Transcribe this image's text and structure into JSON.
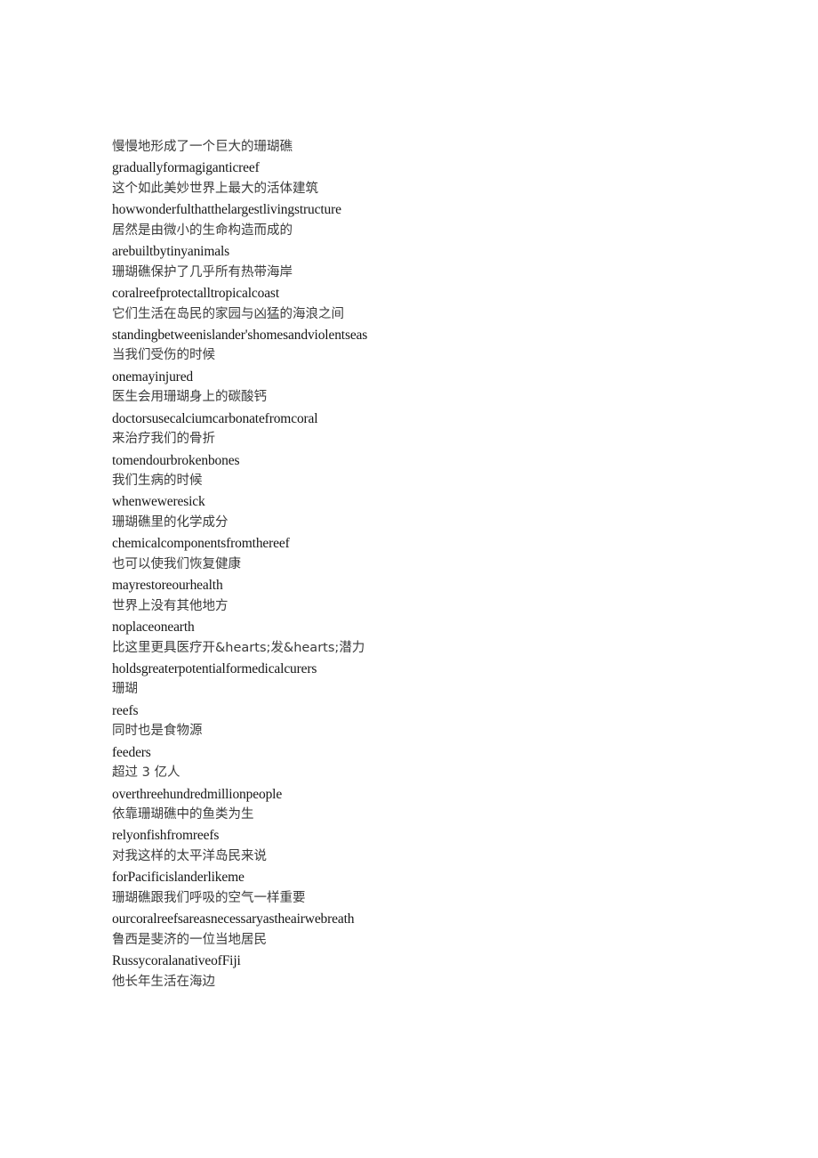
{
  "document": {
    "background_color": "#ffffff",
    "text_color_zh": "#3b3b3b",
    "text_color_en": "#161616",
    "lines": [
      {
        "lang": "zh",
        "text": "慢慢地形成了一个巨大的珊瑚礁"
      },
      {
        "lang": "en",
        "text": "graduallyformagiganticreef"
      },
      {
        "lang": "zh",
        "text": "这个如此美妙世界上最大的活体建筑"
      },
      {
        "lang": "en",
        "text": "howwonderfulthatthelargestlivingstructure"
      },
      {
        "lang": "zh",
        "text": "居然是由微小的生命构造而成的"
      },
      {
        "lang": "en",
        "text": "arebuiltbytinyanimals"
      },
      {
        "lang": "zh",
        "text": "珊瑚礁保护了几乎所有热带海岸"
      },
      {
        "lang": "en",
        "text": "coralreefprotectalltropicalcoast"
      },
      {
        "lang": "zh",
        "text": "它们生活在岛民的家园与凶猛的海浪之间"
      },
      {
        "lang": "en",
        "text": "standingbetweenislander'shomesandviolentseas"
      },
      {
        "lang": "zh",
        "text": "当我们受伤的时候"
      },
      {
        "lang": "en",
        "text": "onemayinjured"
      },
      {
        "lang": "zh",
        "text": "医生会用珊瑚身上的碳酸钙"
      },
      {
        "lang": "en",
        "text": "doctorsusecalciumcarbonatefromcoral"
      },
      {
        "lang": "zh",
        "text": "来治疗我们的骨折"
      },
      {
        "lang": "en",
        "text": "tomendourbrokenbones"
      },
      {
        "lang": "zh",
        "text": "我们生病的时候"
      },
      {
        "lang": "en",
        "text": "whenweweresick"
      },
      {
        "lang": "zh",
        "text": "珊瑚礁里的化学成分"
      },
      {
        "lang": "en",
        "text": "chemicalcomponentsfromthereef"
      },
      {
        "lang": "zh",
        "text": "也可以使我们恢复健康"
      },
      {
        "lang": "en",
        "text": "mayrestoreourhealth"
      },
      {
        "lang": "zh",
        "text": "世界上没有其他地方"
      },
      {
        "lang": "en",
        "text": "noplaceonearth"
      },
      {
        "lang": "zh",
        "text": "比这里更具医疗开&hearts;发&hearts;潜力"
      },
      {
        "lang": "en",
        "text": "holdsgreaterpotentialformedicalcurers"
      },
      {
        "lang": "zh",
        "text": "珊瑚"
      },
      {
        "lang": "en",
        "text": "reefs"
      },
      {
        "lang": "zh",
        "text": "同时也是食物源"
      },
      {
        "lang": "en",
        "text": "feeders"
      },
      {
        "lang": "zh",
        "text": "超过 3 亿人"
      },
      {
        "lang": "en",
        "text": "overthreehundredmillionpeople"
      },
      {
        "lang": "zh",
        "text": "依靠珊瑚礁中的鱼类为生"
      },
      {
        "lang": "en",
        "text": "relyonfishfromreefs"
      },
      {
        "lang": "zh",
        "text": "对我这样的太平洋岛民来说"
      },
      {
        "lang": "en",
        "text": "forPacificislanderlikeme"
      },
      {
        "lang": "zh",
        "text": "珊瑚礁跟我们呼吸的空气一样重要"
      },
      {
        "lang": "en",
        "text": "ourcoralreefsareasnecessaryastheairwebreath"
      },
      {
        "lang": "zh",
        "text": "鲁西是斐济的一位当地居民"
      },
      {
        "lang": "en",
        "text": "RussycoralanativeofFiji"
      },
      {
        "lang": "zh",
        "text": "他长年生活在海边"
      }
    ]
  }
}
